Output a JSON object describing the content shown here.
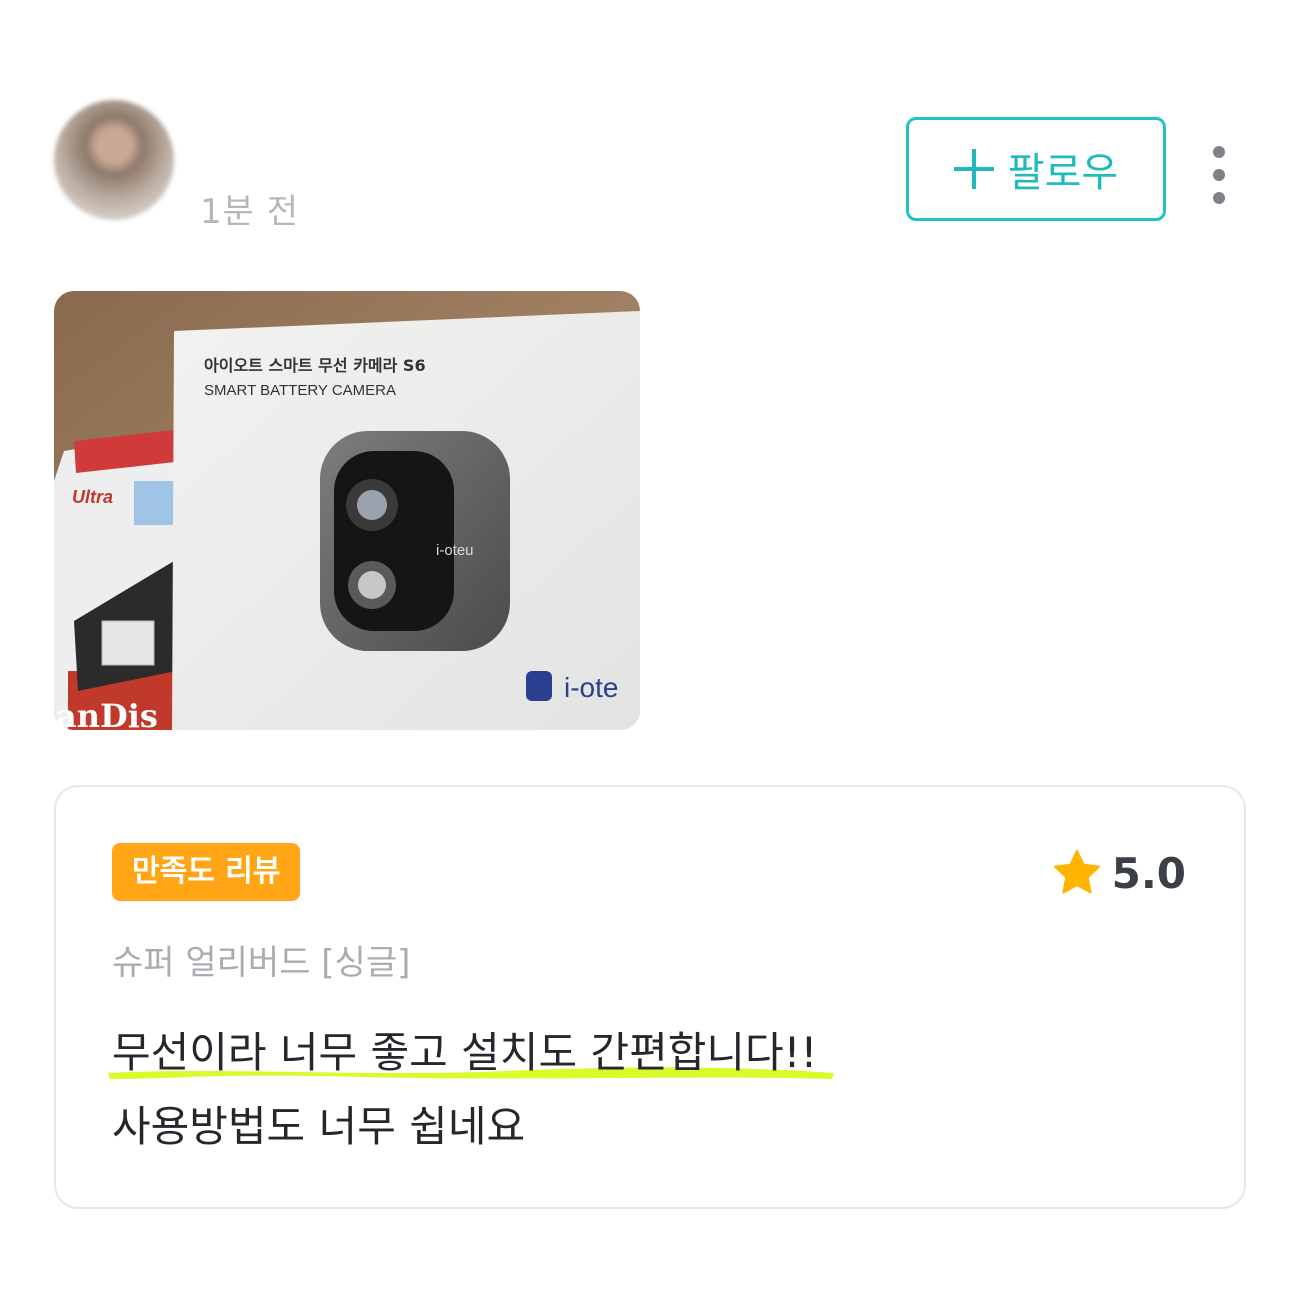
{
  "header": {
    "timestamp": "1분 전",
    "follow_label": "팔로우"
  },
  "photo": {
    "box_title_ko": "아이오트 스마트 무선 카메라 S6",
    "box_title_en": "SMART BATTERY CAMERA",
    "camera_brand": "i-oteu",
    "box_logo": "i-ote",
    "side_product": "Ultra",
    "side_brand": "anDis"
  },
  "review": {
    "badge": "만족도 리뷰",
    "rating": "5.0",
    "option": "슈퍼 얼리버드 [싱글]",
    "line1": "무선이라 너무 좋고 설치도 간편합니다!!",
    "line2": "사용방법도 너무 쉽네요"
  },
  "colors": {
    "accent": "#21c2c9",
    "badge": "#ffa516",
    "star": "#ffb400",
    "highlight": "#d8fb2a"
  },
  "icons": [
    "plus-icon",
    "more-icon",
    "star-icon"
  ]
}
